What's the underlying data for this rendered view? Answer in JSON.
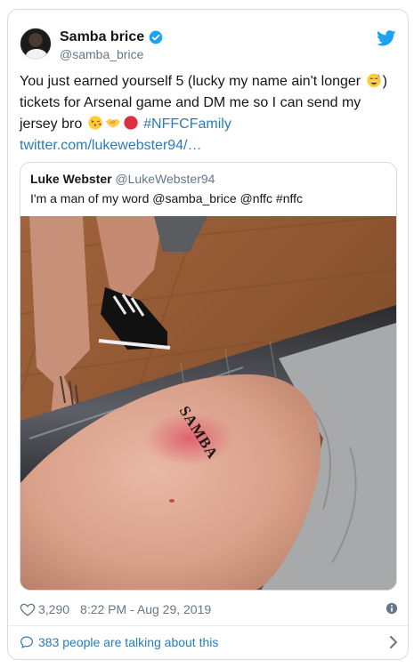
{
  "tweet": {
    "author_name": "Samba brice",
    "author_handle": "@samba_brice",
    "text_1": "You just earned yourself 5 (lucky my name ain't longer ",
    "text_2": ") tickets for Arsenal game and DM me so I can send my jersey bro ",
    "hashtag": "#NFFCFamily",
    "link": "twitter.com/lukewebster94/…",
    "emojis": [
      "sweat-smile-emoji",
      "kissing-face-emoji",
      "handshake-emoji",
      "red-circle-emoji"
    ]
  },
  "quoted": {
    "author_name": "Luke Webster",
    "author_handle": "@LukeWebster94",
    "text": "I'm a man of my word @samba_brice @nffc #nffc",
    "tattoo_text": "SAMBA"
  },
  "meta": {
    "likes": "3,290",
    "timestamp": "8:22 PM - Aug 29, 2019"
  },
  "footer": {
    "talking": "383 people are talking about this"
  },
  "colors": {
    "link": "#2b7bb9",
    "twitter_blue": "#1da1f2",
    "secondary_text": "#657786",
    "border": "#d6dce0"
  }
}
